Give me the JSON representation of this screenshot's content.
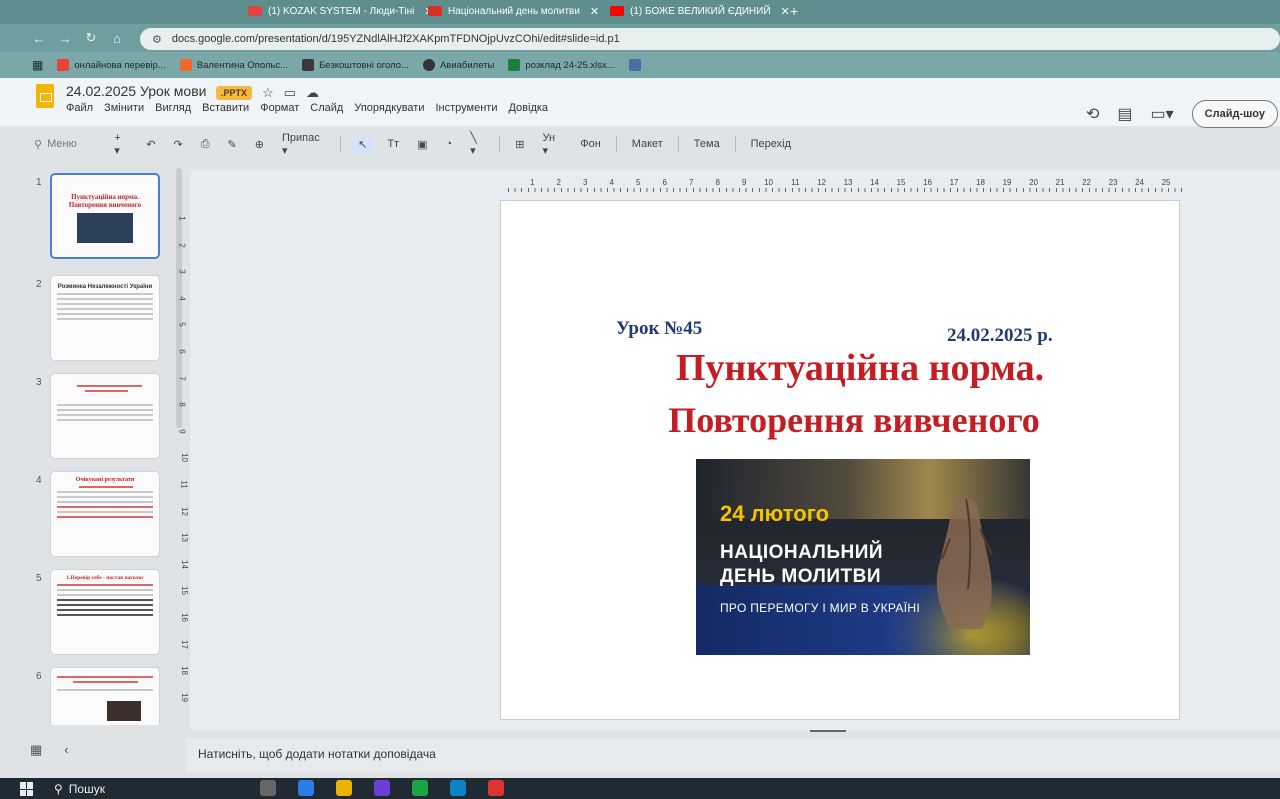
{
  "browser": {
    "tabs": [
      {
        "label": "(1) KOZAK SYSTEM - Люди-Тіні",
        "close": "✕",
        "color": "#e04444"
      },
      {
        "label": "Національний день молитви",
        "close": "✕",
        "color": "#d93025"
      },
      {
        "label": "(1) БОЖЕ ВЕЛИКИЙ ЄДИНИЙ",
        "close": "✕",
        "color": "#ff0000"
      }
    ],
    "new_tab": "+",
    "url": "docs.google.com/presentation/d/195YZNdlAlHJf2XAKpmTFDNOjpUvzCOhi/edit#slide=id.p1",
    "bookmarks": [
      {
        "label": "онлайнова перевір...",
        "color": "#ea4335"
      },
      {
        "label": "Валентина Опольс...",
        "color": "#f2672a"
      },
      {
        "label": "Безкоштовні оголо...",
        "color": "#3a3a3a"
      },
      {
        "label": "Авиабилеты",
        "color": "#333333"
      },
      {
        "label": "розклад 24-25.xlsx...",
        "color": "#188038"
      },
      {
        "label": "",
        "color": "#4a6fa5"
      }
    ]
  },
  "app": {
    "title": "24.02.2025 Урок мови",
    "badge": ".PPTX",
    "menu": [
      "Файл",
      "Змінити",
      "Вигляд",
      "Вставити",
      "Формат",
      "Слайд",
      "Упорядкувати",
      "Інструменти",
      "Довідка"
    ],
    "slideshow": "Слайд-шоу"
  },
  "toolbar": {
    "search": "Меню",
    "zoom_label": "Припас",
    "bg": "Фон",
    "layout": "Макет",
    "theme": "Тема",
    "transition": "Перехід"
  },
  "filmstrip": {
    "numbers": [
      "1",
      "2",
      "3",
      "4",
      "5",
      "6"
    ],
    "slide1_title": "Пунктуаційна норма. Повторення вивченого",
    "slide2_title": "Розминка Незалежності України",
    "slide4_title": "Очікувані результати",
    "slide5_title": "1.Перевір себе - постав паголос"
  },
  "rulers": {
    "h": [
      "1",
      "2",
      "3",
      "4",
      "5",
      "6",
      "7",
      "8",
      "9",
      "10",
      "11",
      "12",
      "13",
      "14",
      "15",
      "16",
      "17",
      "18",
      "19",
      "20",
      "21",
      "22",
      "23",
      "24",
      "25"
    ],
    "v": [
      "1",
      "2",
      "3",
      "4",
      "5",
      "6",
      "7",
      "8",
      "9",
      "10",
      "11",
      "12",
      "13",
      "14",
      "15",
      "16",
      "17",
      "18",
      "19"
    ]
  },
  "slide": {
    "lesson": "Урок №45",
    "date": "24.02.2025 р.",
    "title_line1": "Пунктуаційна норма.",
    "title_line2": "Повторення вивченого",
    "banner": {
      "date": "24 лютого",
      "heading_line1": "НАЦІОНАЛЬНИЙ",
      "heading_line2": "ДЕНЬ МОЛИТВИ",
      "subtitle": "ПРО ПЕРЕМОГУ І МИР В УКРАЇНІ"
    }
  },
  "notes": {
    "placeholder": "Натисніть, щоб додати нотатки доповідача"
  },
  "taskbar": {
    "search": "Пошук"
  }
}
